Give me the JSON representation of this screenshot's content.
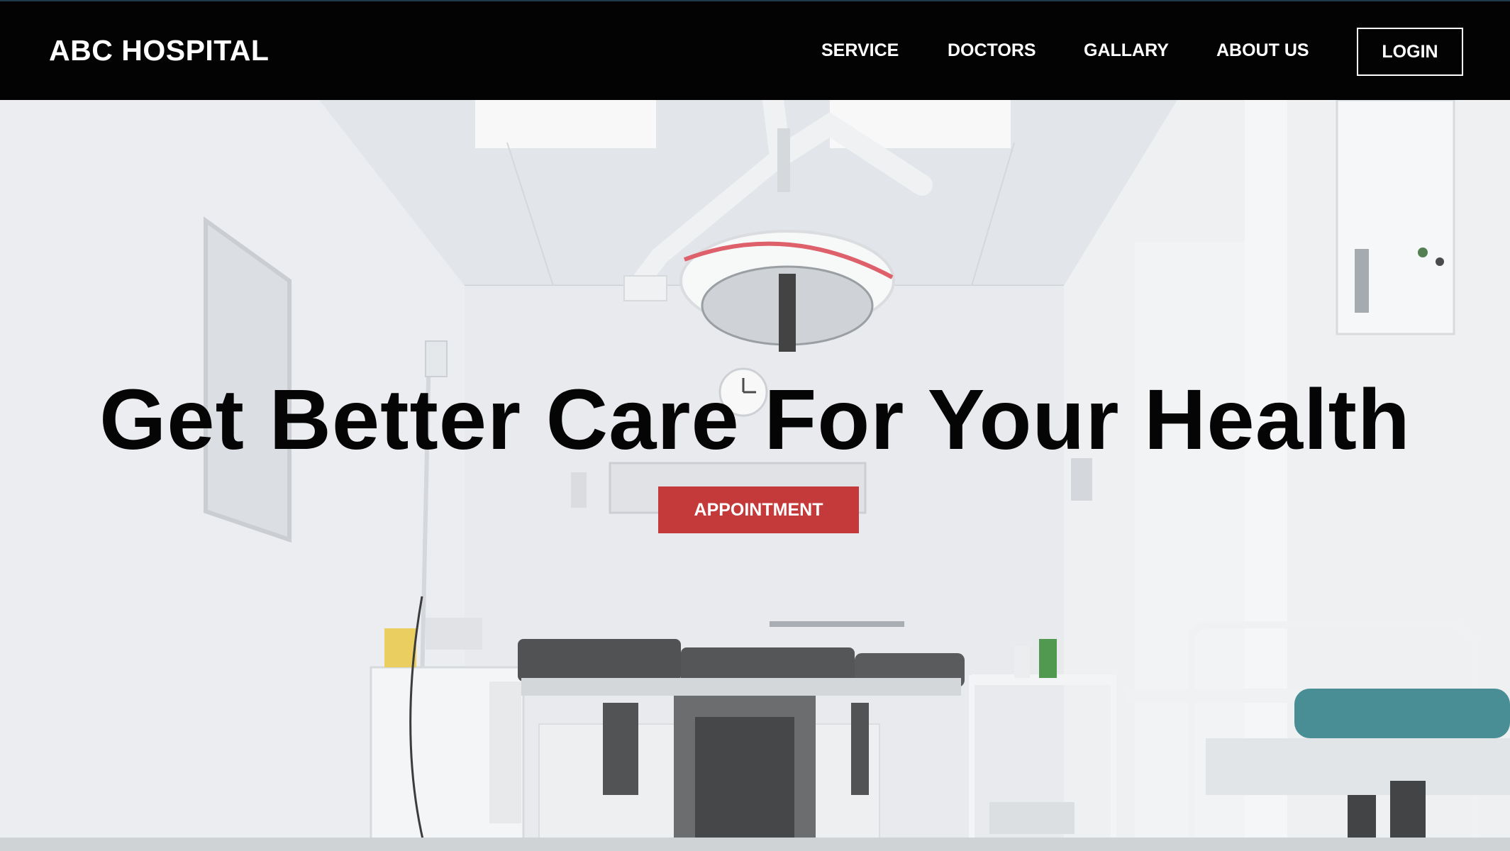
{
  "navbar": {
    "brand": "ABC HOSPITAL",
    "links": [
      "SERVICE",
      "DOCTORS",
      "GALLARY",
      "ABOUT US"
    ],
    "login_label": "LOGIN"
  },
  "hero": {
    "headline": "Get Better Care For Your Health",
    "cta_label": "APPOINTMENT",
    "background": "operating-room-photo"
  },
  "colors": {
    "navbar_bg": "#030303",
    "cta_bg": "#c43a3a",
    "headline": "#050505"
  }
}
